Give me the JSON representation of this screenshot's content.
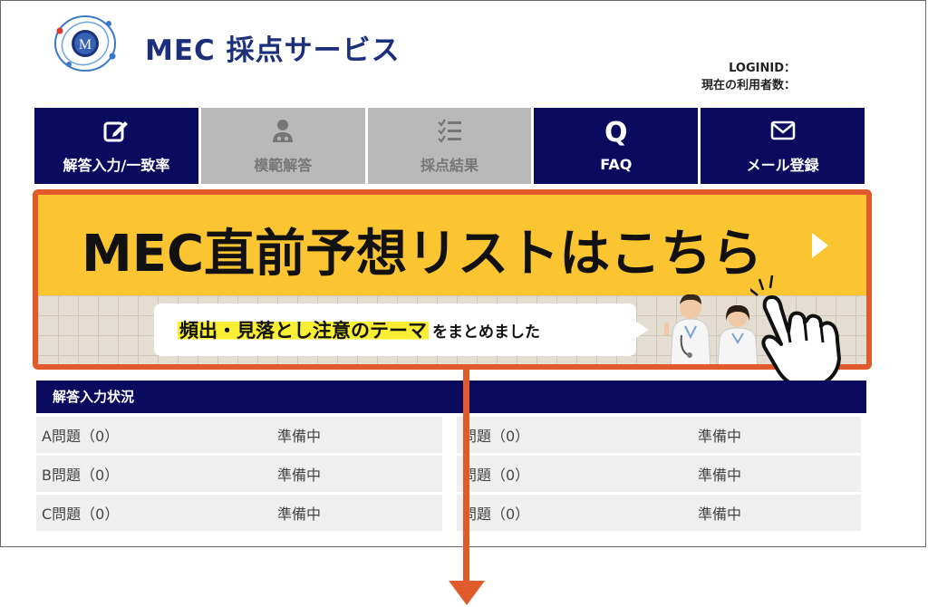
{
  "header": {
    "logo_letter": "M",
    "brand": "MEC 採点サービス",
    "login_label": "LOGINID：",
    "users_label": "現在の利用者数："
  },
  "nav": [
    {
      "label": "解答入力/一致率",
      "icon": "edit-icon",
      "state": "active"
    },
    {
      "label": "模範解答",
      "icon": "doctor-icon",
      "state": "disabled"
    },
    {
      "label": "採点結果",
      "icon": "checklist-icon",
      "state": "disabled"
    },
    {
      "label": "FAQ",
      "icon": "q-icon",
      "glyph": "Q",
      "state": "active"
    },
    {
      "label": "メール登録",
      "icon": "mail-icon",
      "state": "active"
    }
  ],
  "banner": {
    "title": "MEC直前予想リストはこちら",
    "subtitle_highlight": "頻出・見落とし注意のテーマ",
    "subtitle_rest": "をまとめました"
  },
  "status": {
    "title": "解答入力状況",
    "left": [
      {
        "name": "A問題（0）",
        "state": "準備中"
      },
      {
        "name": "B問題（0）",
        "state": "準備中"
      },
      {
        "name": "C問題（0）",
        "state": "準備中"
      }
    ],
    "right": [
      {
        "name": "問題（0）",
        "state": "準備中"
      },
      {
        "name": "問題（0）",
        "state": "準備中"
      },
      {
        "name": "問題（0）",
        "state": "準備中"
      }
    ]
  },
  "colors": {
    "navy": "#0a0b5e",
    "banner_yellow": "#fbc531",
    "accent_orange": "#e05a2b",
    "brand_blue": "#1b2f7a",
    "disabled_gray": "#b9b9b9"
  }
}
